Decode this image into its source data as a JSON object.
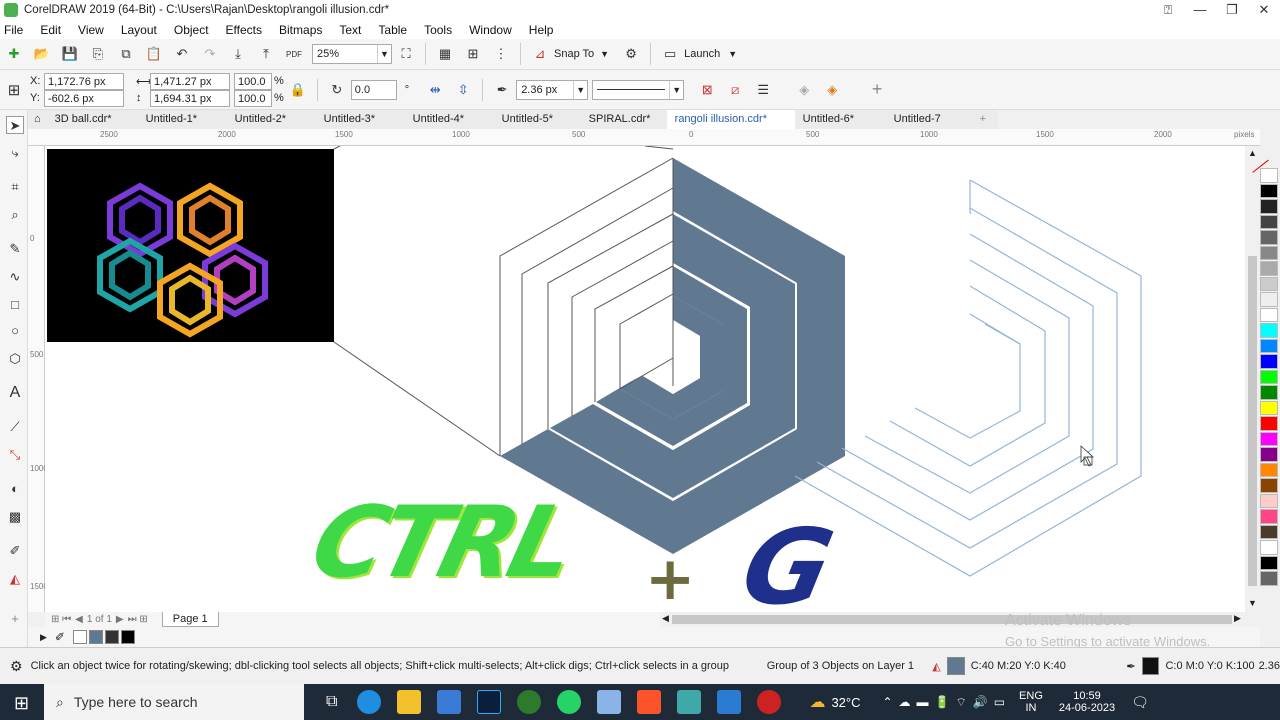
{
  "window": {
    "title": "CorelDRAW 2019 (64-Bit) - C:\\Users\\Rajan\\Desktop\\rangoli illusion.cdr*"
  },
  "menu": [
    "File",
    "Edit",
    "View",
    "Layout",
    "Object",
    "Effects",
    "Bitmaps",
    "Text",
    "Table",
    "Tools",
    "Window",
    "Help"
  ],
  "toolbar": {
    "zoom": "25%",
    "snap_to": "Snap To",
    "launch": "Launch",
    "pdf_label": "PDF"
  },
  "props": {
    "x": "1,172.76 px",
    "y": "-602.6 px",
    "w": "1,471.27 px",
    "h": "1,694.31 px",
    "scale_w": "100.0",
    "scale_h": "100.0",
    "pct": "%",
    "rotation": "0.0",
    "outline_width": "2.36 px",
    "x_label": "X:",
    "y_label": "Y:"
  },
  "tabs": [
    "3D ball.cdr*",
    "Untitled-1*",
    "Untitled-2*",
    "Untitled-3*",
    "Untitled-4*",
    "Untitled-5*",
    "SPIRAL.cdr*",
    "rangoli illusion.cdr*",
    "Untitled-6*",
    "Untitled-7"
  ],
  "active_tab": 7,
  "ruler": {
    "h_ticks": [
      "2500",
      "2000",
      "1500",
      "1000",
      "500",
      "0",
      "500",
      "1000",
      "1500",
      "2000"
    ],
    "h_unit": "pixels",
    "v_ticks": [
      "0",
      "500",
      "1000",
      "1500"
    ]
  },
  "page_nav": {
    "count": "1 of 1",
    "page_tab": "Page 1"
  },
  "status": {
    "hint": "Click an object twice for rotating/skewing; dbl-clicking tool selects all objects; Shift+click multi-selects; Alt+click digs; Ctrl+click selects in a group",
    "selection": "Group of 3 Objects on Layer 1",
    "fill": "C:40 M:20 Y:0 K:40",
    "outline": "C:0 M:0 Y:0 K:100",
    "outline_width": "2.36"
  },
  "watermark": {
    "line1": "Activate Windows",
    "line2": "Go to Settings to activate Windows."
  },
  "overlay": {
    "ctrl": "CTRL",
    "plus": "+",
    "g": "G"
  },
  "taskbar": {
    "search_placeholder": "Type here to search",
    "weather": "32°C",
    "lang1": "ENG",
    "lang2": "IN",
    "time": "10:59",
    "date": "24-06-2023"
  },
  "colors": {
    "fill": "#607890",
    "accent": "#2a5db0",
    "ctrl_green": "#3fd846",
    "g_blue": "#1f2f8c"
  },
  "palette": [
    "#ffffff",
    "#000000",
    "#222222",
    "#444444",
    "#666666",
    "#888888",
    "#aaaaaa",
    "#cccccc",
    "#eeeeee",
    "#ffffff",
    "#00ffff",
    "#0088ff",
    "#0000ff",
    "#00ff00",
    "#008800",
    "#ffff00",
    "#ff0000",
    "#ff00ff",
    "#880088",
    "#ff8800",
    "#884400",
    "#ffcccc",
    "#ff4488",
    "#4a3b2a",
    "#ffffff",
    "#000000",
    "#666666"
  ]
}
